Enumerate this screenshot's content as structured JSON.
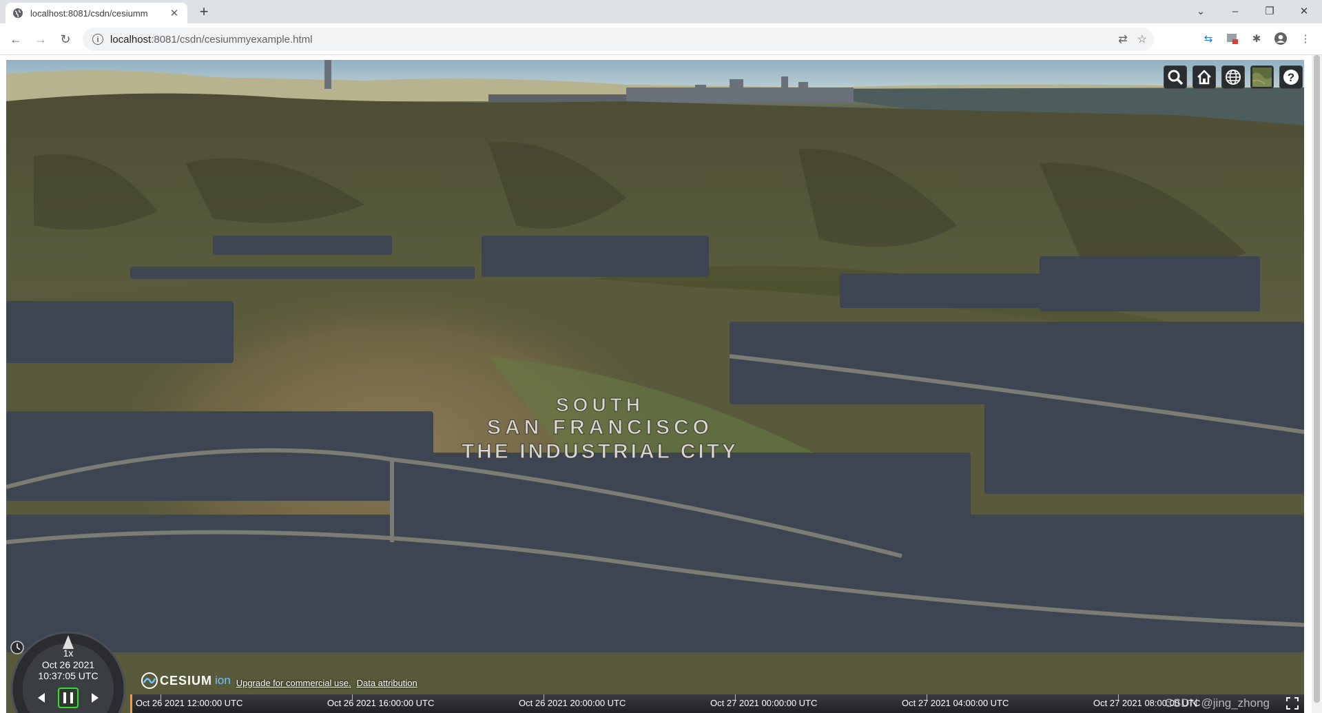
{
  "browser": {
    "tab_title": "localhost:8081/csdn/cesiumm",
    "new_tab_label": "+",
    "url_host": "localhost",
    "url_rest": ":8081/csdn/cesiummyexample.html",
    "window_controls": {
      "minimize": "–",
      "restore": "❐",
      "close": "✕",
      "tab_search": "⌄"
    }
  },
  "viewer": {
    "hillside_text": [
      "SOUTH",
      "SAN FRANCISCO",
      "THE INDUSTRIAL CITY"
    ],
    "toolbar_icons": [
      "search-icon",
      "home-icon",
      "globe-icon",
      "imagery-layer-icon",
      "help-icon"
    ],
    "clock": {
      "speed": "1x",
      "date": "Oct 26 2021",
      "time": "10:37:05 UTC"
    },
    "credits": {
      "logo_text": "CESIUM",
      "logo_suffix": "ion",
      "upgrade_link": "Upgrade for commercial use.",
      "attribution_link": "Data attribution"
    },
    "timeline": {
      "labels": [
        "Oct 26 2021 12:00:00 UTC",
        "Oct 26 2021 16:00:00 UTC",
        "Oct 26 2021 20:00:00 UTC",
        "Oct 27 2021 00:00:00 UTC",
        "Oct 27 2021 04:00:00 UTC",
        "Oct 27 2021 08:00:00 UTC"
      ]
    },
    "watermark": "CSDN @jing_zhong"
  },
  "colors": {
    "sky": "#9fbccb",
    "water": "#4a5a5c",
    "hills": "#4f5233",
    "buildings": "#3b4350",
    "cesium_button_bg": "#2a2d30"
  }
}
